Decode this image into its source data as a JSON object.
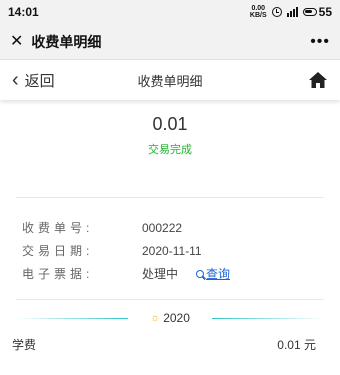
{
  "status_bar": {
    "time": "14:01",
    "signal_text": "0.00\nKB/S",
    "battery": "55"
  },
  "mini_program": {
    "title": "收费单明细"
  },
  "nav": {
    "back_label": "返回",
    "title": "收费单明细"
  },
  "summary": {
    "amount": "0.01",
    "status": "交易完成",
    "status_color": "#1fb52e"
  },
  "details": [
    {
      "label": "收费单号:",
      "value": "000222"
    },
    {
      "label": "交易日期:",
      "value": "2020-11-11"
    },
    {
      "label": "电子票据:",
      "value": "处理中"
    }
  ],
  "query_link": "查询",
  "year": "2020",
  "fees": [
    {
      "name": "学费",
      "amount": "0.01 元"
    }
  ]
}
